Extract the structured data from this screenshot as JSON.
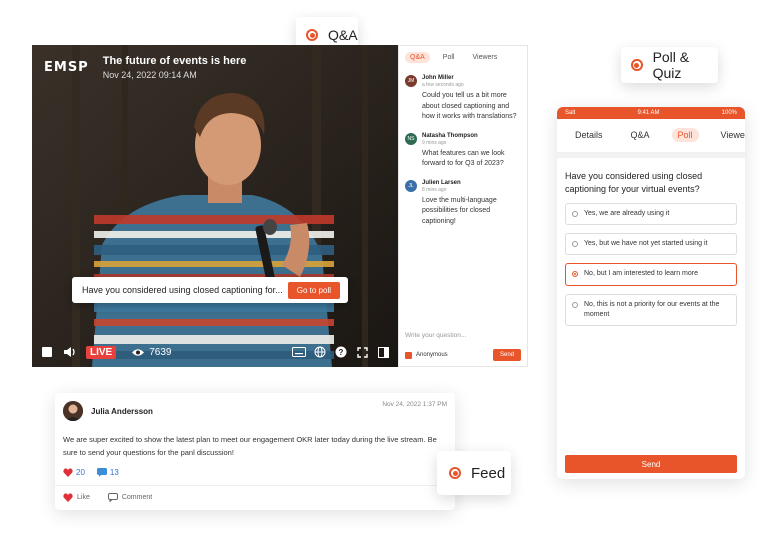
{
  "tags": {
    "qa": "Q&A",
    "poll_quiz": "Poll & Quiz",
    "feed": "Feed"
  },
  "player": {
    "logo": "EMSP",
    "title": "The future of events is here",
    "date": "Nov 24, 2022 09:14 AM",
    "poll_prompt": "Have you considered using closed captioning for...",
    "go_to_poll": "Go to poll",
    "live": "LIVE",
    "viewers": "7639"
  },
  "chat": {
    "tabs": [
      "Q&A",
      "Poll",
      "Viewers"
    ],
    "messages": [
      {
        "initials": "JM",
        "name": "John Miller",
        "time": "a few seconds ago",
        "text": "Could you tell us a bit more about closed captioning and how it works with translations?",
        "color": "#7a3b2e"
      },
      {
        "initials": "NS",
        "name": "Natasha Thompson",
        "time": "9 mins ago",
        "text": "What features can we look forward to for Q3 of 2023?",
        "color": "#2e6b52"
      },
      {
        "initials": "JL",
        "name": "Julien Larsen",
        "time": "8 mins ago",
        "text": "Love the multi-language possibilities for closed captioning!",
        "color": "#3a6fa8"
      }
    ],
    "input_placeholder": "Write your question...",
    "anonymous": "Anonymous",
    "send": "Send"
  },
  "phone": {
    "status_carrier": "Salt",
    "status_time": "9:41 AM",
    "status_battery": "100%",
    "tabs": [
      "Details",
      "Q&A",
      "Poll",
      "Viewers"
    ],
    "question": "Have you considered using closed captioning for your virtual events?",
    "options": [
      "Yes, we are already using it",
      "Yes, but we have not yet started using it",
      "No, but I am interested to learn more",
      "No, this is not a priority for our events at the moment"
    ],
    "send": "Send"
  },
  "feed": {
    "name": "Julia Andersson",
    "date": "Nov 24, 2022 1:37 PM",
    "text": "We are super excited to show the latest plan to meet our engagement OKR later today during the live stream. Be sure to send your questions for the panl discussion!",
    "likes": "20",
    "comments": "13",
    "like_label": "Like",
    "comment_label": "Comment"
  },
  "colors": {
    "accent": "#e8552b",
    "live": "#e8403b"
  }
}
